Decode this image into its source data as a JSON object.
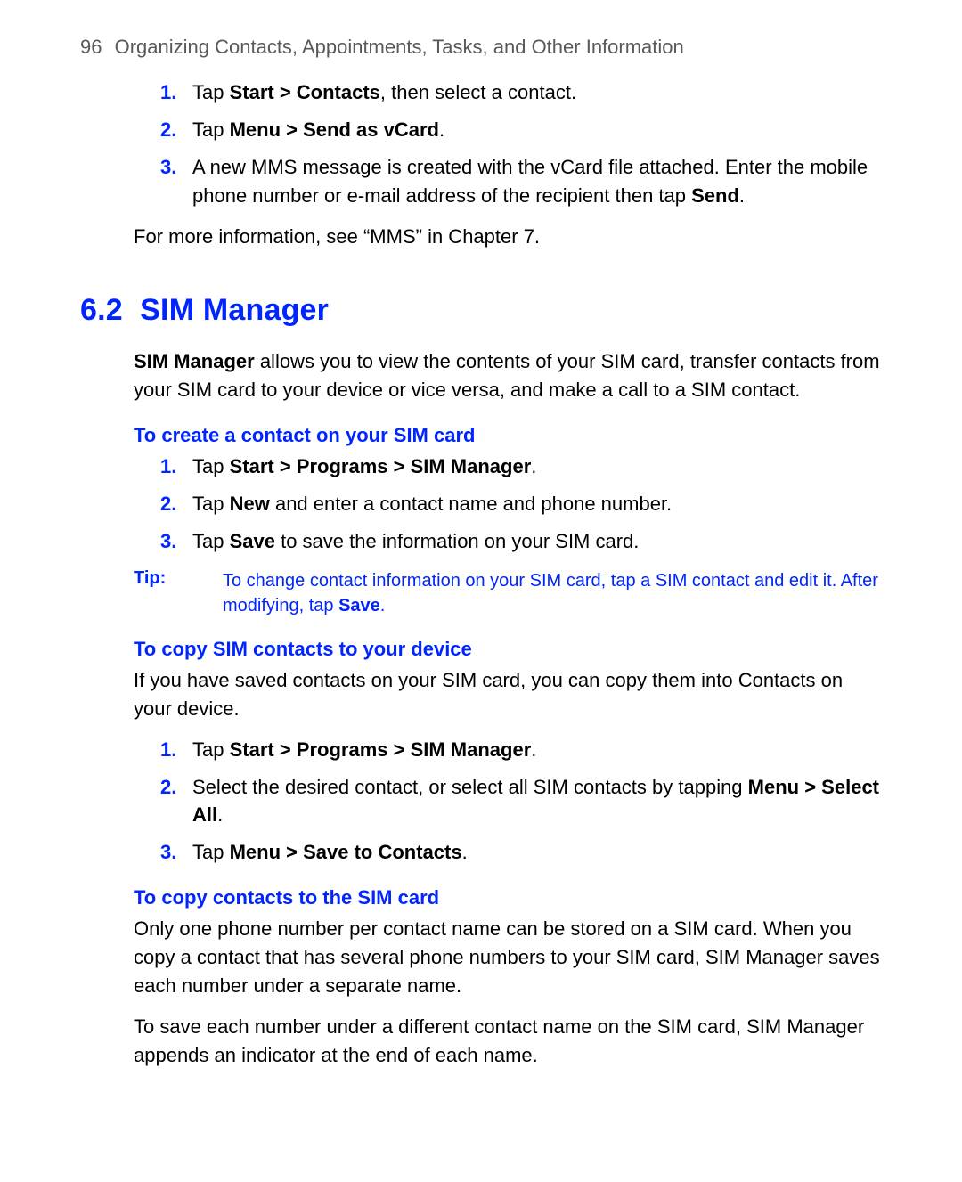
{
  "header": {
    "page_number": "96",
    "chapter_title": "Organizing Contacts, Appointments, Tasks, and Other Information"
  },
  "intro_steps": [
    {
      "n": "1.",
      "pre": "Tap ",
      "bold": "Start > Contacts",
      "post": ", then select a contact."
    },
    {
      "n": "2.",
      "pre": "Tap ",
      "bold": "Menu > Send as vCard",
      "post": "."
    },
    {
      "n": "3.",
      "pre": "A new MMS message is created with the vCard file attached. Enter the mobile phone number or e-mail address of the recipient then tap ",
      "bold": "Send",
      "post": "."
    }
  ],
  "intro_more": "For more information, see “MMS” in Chapter 7.",
  "section_number": "6.2",
  "section_title": "SIM Manager",
  "section_intro_bold": "SIM Manager",
  "section_intro_rest": " allows you to view the contents of your SIM card, transfer contacts from your SIM card to your device or vice versa, and make a call to a SIM contact.",
  "sub1_title": "To create a contact on your SIM card",
  "sub1_steps": [
    {
      "n": "1.",
      "pre": "Tap ",
      "bold": "Start > Programs > SIM Manager",
      "post": "."
    },
    {
      "n": "2.",
      "pre": "Tap ",
      "bold": "New",
      "post": " and enter a contact name and phone number."
    },
    {
      "n": "3.",
      "pre": "Tap ",
      "bold": "Save",
      "post": " to save the information on your SIM card."
    }
  ],
  "tip_label": "Tip:",
  "tip_pre": "To change contact information on your SIM card, tap a SIM contact and edit it. After modifying, tap ",
  "tip_bold": "Save",
  "tip_post": ".",
  "sub2_title": "To copy SIM contacts to your device",
  "sub2_intro": "If you have saved contacts on your SIM card, you can copy them into Contacts on your device.",
  "sub2_steps": [
    {
      "n": "1.",
      "pre": "Tap ",
      "bold": "Start > Programs > SIM Manager",
      "post": "."
    },
    {
      "n": "2.",
      "pre": "Select the desired contact, or select all SIM contacts by tapping ",
      "bold": "Menu > Select All",
      "post": "."
    },
    {
      "n": "3.",
      "pre": "Tap ",
      "bold": "Menu > Save to Contacts",
      "post": "."
    }
  ],
  "sub3_title": "To copy contacts to the SIM card",
  "sub3_p1": "Only one phone number per contact name can be stored on a SIM card. When you copy a contact that has several phone numbers to your SIM card, SIM Manager saves each number under a separate name.",
  "sub3_p2": "To save each number under a different contact name on the SIM card, SIM Manager appends an indicator at the end of each name."
}
